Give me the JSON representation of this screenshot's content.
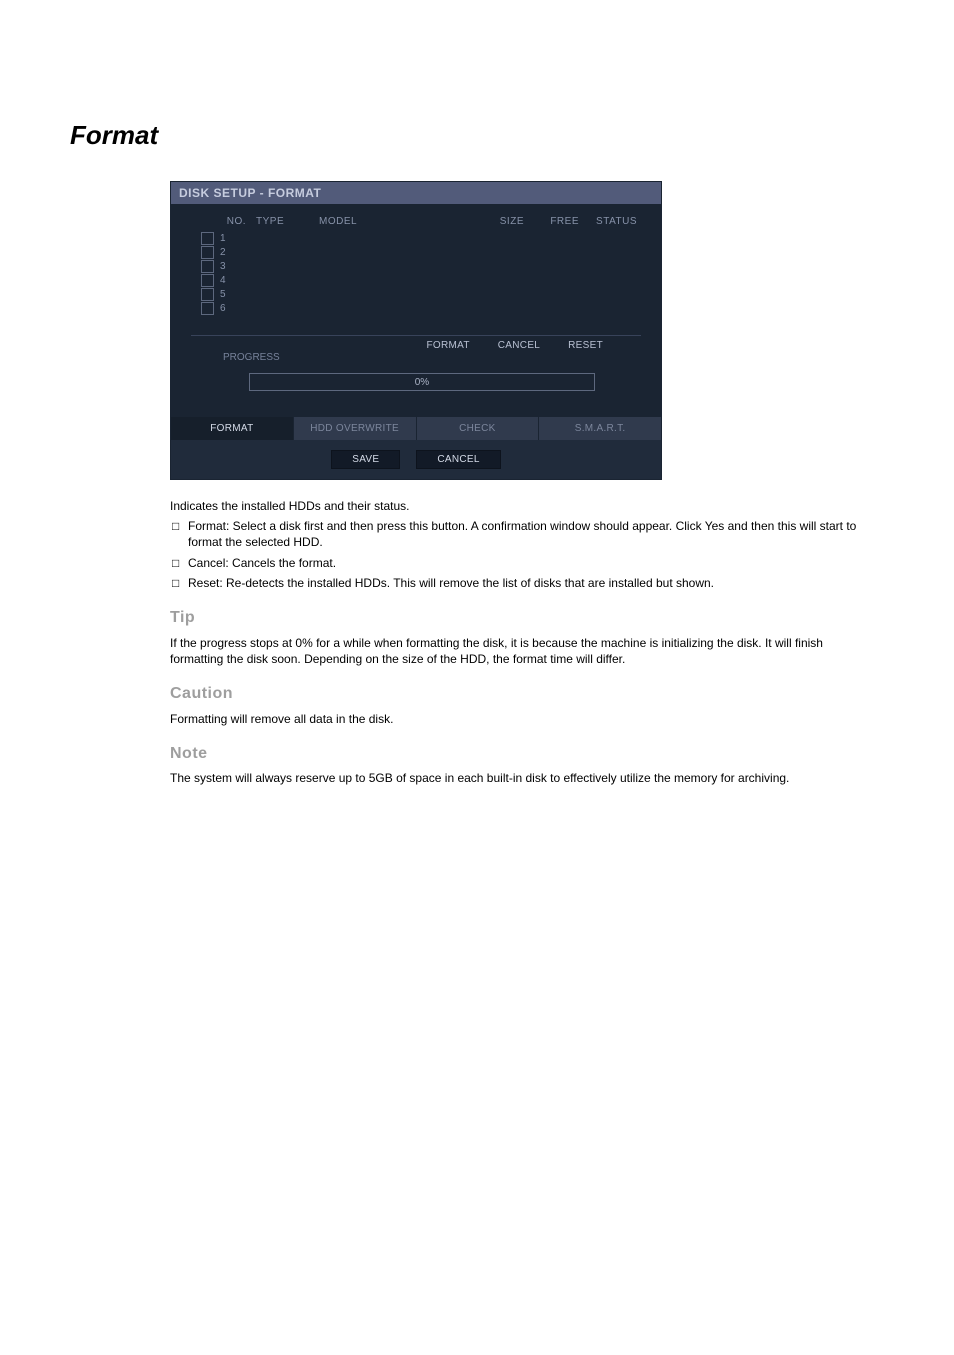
{
  "section_title": "Format",
  "dialog": {
    "titlebar": "DISK SETUP - FORMAT",
    "headers": {
      "no": "NO.",
      "type": "TYPE",
      "model": "MODEL",
      "size": "SIZE",
      "free": "FREE",
      "status": "STATUS"
    },
    "rows": [
      {
        "no": "1"
      },
      {
        "no": "2"
      },
      {
        "no": "3"
      },
      {
        "no": "4"
      },
      {
        "no": "5"
      },
      {
        "no": "6"
      }
    ],
    "ops": {
      "label": "PROGRESS",
      "format": "FORMAT",
      "cancel": "CANCEL",
      "reset": "RESET"
    },
    "progress_text": "0%",
    "tabs": {
      "format": "FORMAT",
      "overwrite": "HDD OVERWRITE",
      "check": "CHECK",
      "smart": "S.M.A.R.T."
    },
    "footer": {
      "save": "SAVE",
      "cancel": "CANCEL"
    }
  },
  "body": {
    "p1": "Indicates the installed HDDs and their status.",
    "li1": "Format: Select a disk first and then press this button. A confirmation window should appear. Click Yes and then this will start to format the selected HDD.",
    "li2": "Cancel: Cancels the format.",
    "li3": "Reset: Re-detects the installed HDDs. This will remove the list of disks that are installed but shown.",
    "tip_head": "Tip",
    "tip_text": "If the progress stops at 0% for a while when formatting the disk, it is because the machine is initializing the disk. It will finish formatting the disk soon. Depending on the size of the HDD, the format time will differ.",
    "caution_head": "Caution",
    "caution_text": "Formatting will remove all data in the disk.",
    "note_head": "Note",
    "note_text": "The system will always reserve up to 5GB of space in each built-in disk to effectively utilize the memory for archiving."
  }
}
